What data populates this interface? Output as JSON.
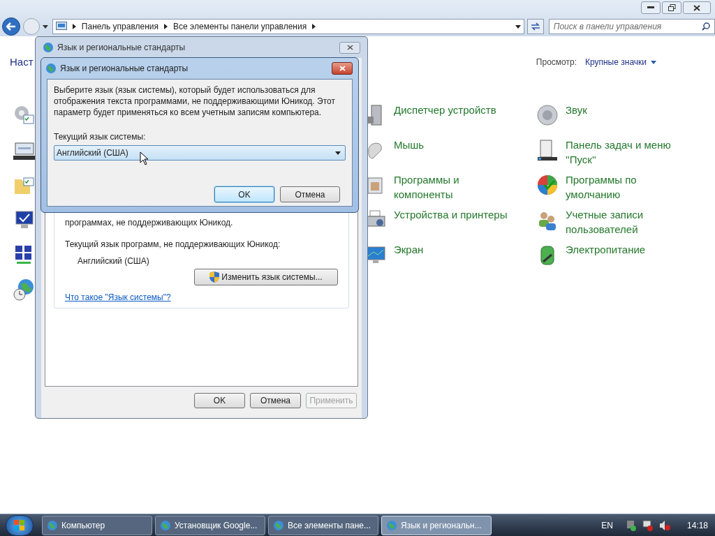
{
  "explorer": {
    "breadcrumbs": [
      "Панель управления",
      "Все элементы панели управления"
    ],
    "search": {
      "placeholder": "Поиск в панели управления"
    },
    "heading": "Наст",
    "view": {
      "label": "Просмотр:",
      "value": "Крупные значки"
    },
    "columns": [
      [
        {
          "label": "Диспетчер устройств"
        },
        {
          "label": "Мышь"
        },
        {
          "label": "Программы и\nкомпоненты"
        },
        {
          "label": "Устройства и принтеры"
        },
        {
          "label": "Экран"
        }
      ],
      [
        {
          "label": "Звук"
        },
        {
          "label": "Панель задач и меню\n''Пуск''"
        },
        {
          "label": "Программы по\nумолчанию"
        },
        {
          "label": "Учетные записи\nпользователей"
        },
        {
          "label": "Электропитание"
        }
      ]
    ]
  },
  "region_dialog": {
    "title": "Язык и региональные стандарты",
    "partial_text": "программах, не поддерживающих Юникод.",
    "current_label": "Текущий язык программ, не поддерживающих Юникод:",
    "current_value": "Английский (США)",
    "change_button": "Изменить язык системы...",
    "help_link": "Что такое \"Язык системы\"?",
    "buttons": [
      {
        "label": "OK",
        "disabled": false
      },
      {
        "label": "Отмена",
        "disabled": false
      },
      {
        "label": "Применить",
        "disabled": true
      }
    ]
  },
  "system_locale_dialog": {
    "title": "Язык и региональные стандарты",
    "description": "Выберите язык (язык системы), который будет использоваться для отображения текста программами, не поддерживающими Юникод. Этот параметр будет применяться ко всем учетным записям компьютера.",
    "select_label": "Текущий язык системы:",
    "select_value": "Английский (США)",
    "buttons": [
      {
        "label": "OK",
        "default": true
      },
      {
        "label": "Отмена",
        "default": false
      }
    ]
  },
  "taskbar": {
    "tasks": [
      {
        "label": "Компьютер",
        "selected": false
      },
      {
        "label": "Установщик Google...",
        "selected": false
      },
      {
        "label": "Все элементы пане...",
        "selected": false
      },
      {
        "label": "Язык и региональн...",
        "selected": true
      }
    ],
    "language": "EN",
    "clock": "14:18"
  }
}
